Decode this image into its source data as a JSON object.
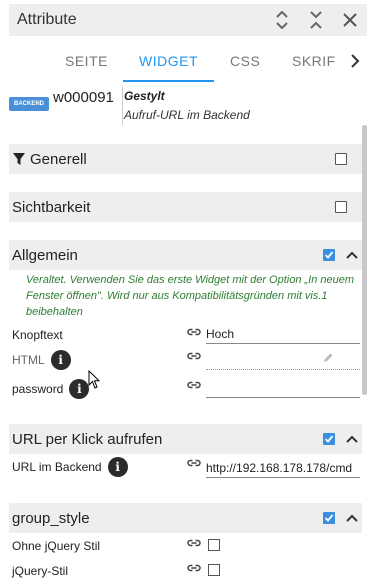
{
  "header": {
    "title": "Attribute"
  },
  "tabs": [
    {
      "label": "SEITE",
      "active": false
    },
    {
      "label": "WIDGET",
      "active": true
    },
    {
      "label": "CSS",
      "active": false
    },
    {
      "label": "SKRIF",
      "active": false
    }
  ],
  "widget": {
    "icon_label": "BACKEND",
    "id": "w000091",
    "set": "Gestylt",
    "description": "Aufruf-URL im Backend"
  },
  "sections": {
    "generell": {
      "title": "Generell",
      "checked": false
    },
    "sichtbarkeit": {
      "title": "Sichtbarkeit",
      "checked": false
    },
    "allgemein": {
      "title": "Allgemein",
      "checked": true
    },
    "url": {
      "title": "URL per Klick aufrufen",
      "checked": true
    },
    "group_style": {
      "title": "group_style",
      "checked": true
    }
  },
  "note": "Veraltet. Verwenden Sie das erste Widget mit der Option „In neuem Fenster öffnen\". Wird nur aus Kompatibilitätsgründen mit vis.1 beibehalten",
  "fields": {
    "knopftext": {
      "label": "Knopftext",
      "value": "Hoch"
    },
    "html": {
      "label": "HTML",
      "value": ""
    },
    "password": {
      "label": "password",
      "value": ""
    },
    "url_backend": {
      "label": "URL im Backend",
      "value": "http://192.168.178.178/cmd"
    },
    "ohne_jquery": {
      "label": "Ohne jQuery Stil",
      "checked": false
    },
    "jquery_stil": {
      "label": "jQuery-Stil",
      "checked": false
    }
  },
  "icons": {
    "info": "i",
    "accent": "#2196f3",
    "checkbox_checked": "#3b8fdf",
    "note_color": "#2e7d32"
  }
}
